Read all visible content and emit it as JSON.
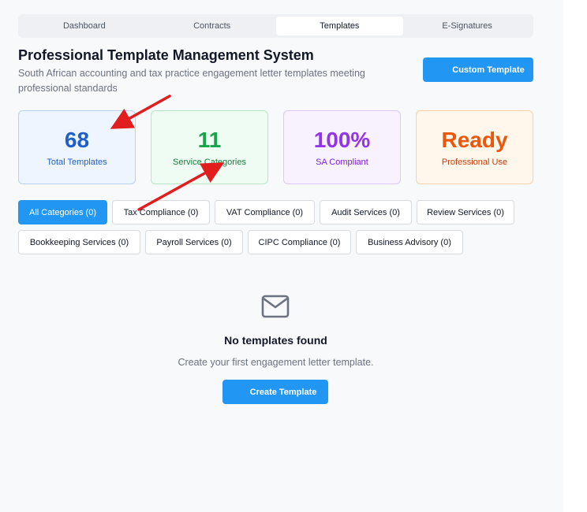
{
  "tabs": [
    {
      "label": "Dashboard",
      "active": false
    },
    {
      "label": "Contracts",
      "active": false
    },
    {
      "label": "Templates",
      "active": true
    },
    {
      "label": "E-Signatures",
      "active": false
    }
  ],
  "header": {
    "title": "Professional Template Management System",
    "subtitle": "South African accounting and tax practice engagement letter templates meeting professional standards",
    "custom_template_label": "Custom Template"
  },
  "stats": [
    {
      "value": "68",
      "label": "Total Templates",
      "color": "#1f5fc9"
    },
    {
      "value": "11",
      "label": "Service Categories",
      "color": "#16a34a"
    },
    {
      "value": "100%",
      "label": "SA Compliant",
      "color": "#9333ea"
    },
    {
      "value": "Ready",
      "label": "Professional Use",
      "color": "#ea580c"
    }
  ],
  "categories": [
    {
      "label": "All Categories (0)",
      "active": true
    },
    {
      "label": "Tax Compliance (0)",
      "active": false
    },
    {
      "label": "VAT Compliance (0)",
      "active": false
    },
    {
      "label": "Audit Services (0)",
      "active": false
    },
    {
      "label": "Review Services (0)",
      "active": false
    },
    {
      "label": "Bookkeeping Services (0)",
      "active": false
    },
    {
      "label": "Payroll Services (0)",
      "active": false
    },
    {
      "label": "CIPC Compliance (0)",
      "active": false
    },
    {
      "label": "Business Advisory (0)",
      "active": false
    }
  ],
  "empty_state": {
    "icon": "mail-icon",
    "title": "No templates found",
    "description": "Create your first engagement letter template.",
    "button_label": "Create Template"
  },
  "colors": {
    "accent": "#2196f3",
    "annotation_arrow": "#e11d1d"
  }
}
